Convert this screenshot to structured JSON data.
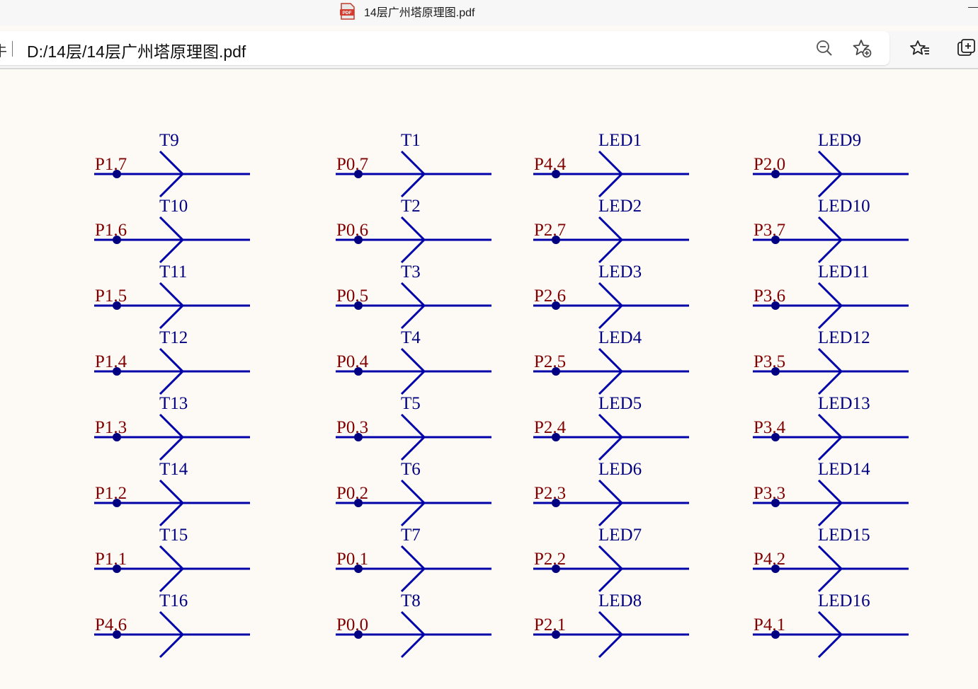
{
  "tab": {
    "title": "14层广州塔原理图.pdf",
    "icon": "pdf-file-icon",
    "icon_label": "PDF"
  },
  "addressbar": {
    "prefix": "牛",
    "url": "D:/14层/14层广州塔原理图.pdf",
    "buttons": [
      "zoom-out-icon",
      "add-favorite-icon"
    ]
  },
  "toolbar": {
    "buttons": [
      "favorites-icon",
      "collections-icon"
    ]
  },
  "colors": {
    "wire": "#0000a8",
    "junction": "#000080",
    "port_label": "#800000",
    "net_label": "#000080",
    "page_background": "#fdfaf6"
  },
  "schematic": {
    "columns": [
      {
        "ports": [
          {
            "port": "P1.7",
            "net": "T9"
          },
          {
            "port": "P1.6",
            "net": "T10"
          },
          {
            "port": "P1.5",
            "net": "T11"
          },
          {
            "port": "P1.4",
            "net": "T12"
          },
          {
            "port": "P1.3",
            "net": "T13"
          },
          {
            "port": "P1.2",
            "net": "T14"
          },
          {
            "port": "P1.1",
            "net": "T15"
          },
          {
            "port": "P4.6",
            "net": "T16"
          }
        ]
      },
      {
        "ports": [
          {
            "port": "P0.7",
            "net": "T1"
          },
          {
            "port": "P0.6",
            "net": "T2"
          },
          {
            "port": "P0.5",
            "net": "T3"
          },
          {
            "port": "P0.4",
            "net": "T4"
          },
          {
            "port": "P0.3",
            "net": "T5"
          },
          {
            "port": "P0.2",
            "net": "T6"
          },
          {
            "port": "P0.1",
            "net": "T7"
          },
          {
            "port": "P0.0",
            "net": "T8"
          }
        ]
      },
      {
        "ports": [
          {
            "port": "P4.4",
            "net": "LED1"
          },
          {
            "port": "P2.7",
            "net": "LED2"
          },
          {
            "port": "P2.6",
            "net": "LED3"
          },
          {
            "port": "P2.5",
            "net": "LED4"
          },
          {
            "port": "P2.4",
            "net": "LED5"
          },
          {
            "port": "P2.3",
            "net": "LED6"
          },
          {
            "port": "P2.2",
            "net": "LED7"
          },
          {
            "port": "P2.1",
            "net": "LED8"
          }
        ]
      },
      {
        "ports": [
          {
            "port": "P2.0",
            "net": "LED9"
          },
          {
            "port": "P3.7",
            "net": "LED10"
          },
          {
            "port": "P3.6",
            "net": "LED11"
          },
          {
            "port": "P3.5",
            "net": "LED12"
          },
          {
            "port": "P3.4",
            "net": "LED13"
          },
          {
            "port": "P3.3",
            "net": "LED14"
          },
          {
            "port": "P4.2",
            "net": "LED15"
          },
          {
            "port": "P4.1",
            "net": "LED16"
          }
        ]
      }
    ]
  }
}
